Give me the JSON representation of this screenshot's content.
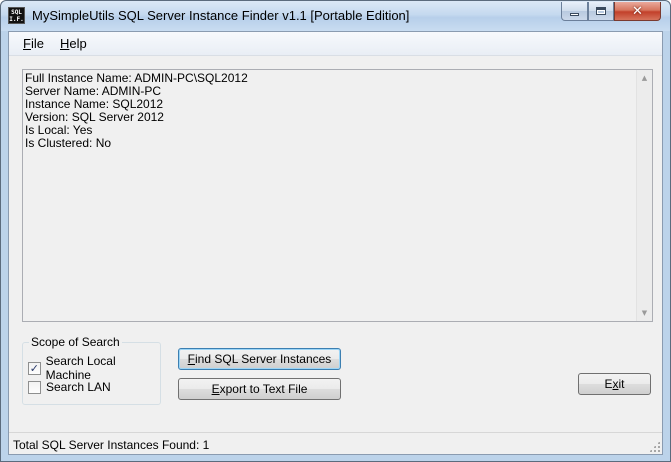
{
  "window": {
    "title": "MySimpleUtils SQL Server Instance Finder v1.1 [Portable Edition]",
    "icon_text": "SQL I.F.",
    "controls": {
      "minimize": "minimize-icon",
      "maximize": "maximize-icon",
      "close": "close-icon"
    }
  },
  "menu": {
    "file": {
      "accel": "F",
      "rest": "ile"
    },
    "help": {
      "accel": "H",
      "rest": "elp"
    }
  },
  "output": {
    "lines": [
      "Full Instance Name: ADMIN-PC\\SQL2012",
      "Server Name: ADMIN-PC",
      "Instance Name: SQL2012",
      "Version: SQL Server 2012",
      "Is Local: Yes",
      "Is Clustered: No"
    ]
  },
  "scope": {
    "legend": "Scope of Search",
    "local": {
      "label": "Search Local Machine",
      "checked": true
    },
    "lan": {
      "label": "Search LAN",
      "checked": false
    }
  },
  "buttons": {
    "find": {
      "accel": "F",
      "rest": "ind SQL Server Instances"
    },
    "export": {
      "accel": "E",
      "rest": "xport to Text File"
    },
    "exit": {
      "pre": "E",
      "accel": "x",
      "rest": "it"
    }
  },
  "status": {
    "text": "Total SQL Server Instances Found: 1"
  },
  "colors": {
    "title_bar": "#c5d9ef",
    "close_button": "#c2402a",
    "client_bg": "#f0f0f0"
  }
}
